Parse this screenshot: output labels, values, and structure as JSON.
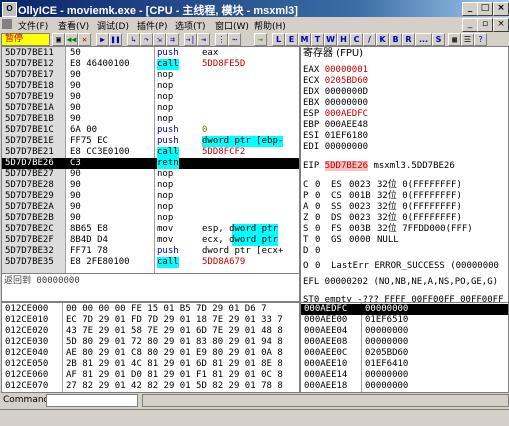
{
  "window": {
    "title": "OllyICE - moviemk.exe - [CPU - 主线程, 模块 - msxml3]",
    "icon": "O"
  },
  "window_buttons": {
    "minimize": "_",
    "maximize": "□",
    "close": "×"
  },
  "menu": [
    "文件(F)",
    "查看(V)",
    "调试(D)",
    "插件(P)",
    "选项(T)",
    "窗口(W)",
    "帮助(H)"
  ],
  "status_label": "暂停",
  "toolbar_letters": [
    "L",
    "E",
    "M",
    "T",
    "W",
    "H",
    "C",
    "/",
    "K",
    "B",
    "R",
    "...",
    "S"
  ],
  "disasm": [
    {
      "addr": "5D7D7BE11",
      "hex": "50",
      "op": "push",
      "arg": "eax",
      "cls": ""
    },
    {
      "addr": "5D7D7BE12",
      "hex": "E8 46400100",
      "op": "call",
      "arg": "5DD8FE5D",
      "cls": "call"
    },
    {
      "addr": "5D7D7BE17",
      "hex": "90",
      "op": "nop",
      "arg": "",
      "cls": ""
    },
    {
      "addr": "5D7D7BE18",
      "hex": "90",
      "op": "nop",
      "arg": "",
      "cls": ""
    },
    {
      "addr": "5D7D7BE19",
      "hex": "90",
      "op": "nop",
      "arg": "",
      "cls": ""
    },
    {
      "addr": "5D7D7BE1A",
      "hex": "90",
      "op": "nop",
      "arg": "",
      "cls": ""
    },
    {
      "addr": "5D7D7BE1B",
      "hex": "90",
      "op": "nop",
      "arg": "",
      "cls": ""
    },
    {
      "addr": "5D7D7BE1C",
      "hex": "6A 00",
      "op": "push",
      "arg": "0",
      "cls": ""
    },
    {
      "addr": "5D7D7BE1E",
      "hex": "FF75 EC",
      "op": "push",
      "arg": "dword ptr [ebp-",
      "cls": "hlarg"
    },
    {
      "addr": "5D7D7BE21",
      "hex": "E8 CC3E0100",
      "op": "call",
      "arg": "5DD8FCF2",
      "cls": "call"
    },
    {
      "addr": "5D7D7BE26",
      "hex": "C3",
      "op": "retn",
      "arg": "",
      "cls": "sel"
    },
    {
      "addr": "5D7D7BE27",
      "hex": "90",
      "op": "nop",
      "arg": "",
      "cls": ""
    },
    {
      "addr": "5D7D7BE28",
      "hex": "90",
      "op": "nop",
      "arg": "",
      "cls": ""
    },
    {
      "addr": "5D7D7BE29",
      "hex": "90",
      "op": "nop",
      "arg": "",
      "cls": ""
    },
    {
      "addr": "5D7D7BE2A",
      "hex": "90",
      "op": "nop",
      "arg": "",
      "cls": ""
    },
    {
      "addr": "5D7D7BE2B",
      "hex": "90",
      "op": "nop",
      "arg": "",
      "cls": ""
    },
    {
      "addr": "5D7D7BE2C",
      "hex": "8B65 E8",
      "op": "mov",
      "arg": "esp, dword ptr",
      "cls": "hlarg2"
    },
    {
      "addr": "5D7D7BE2F",
      "hex": "8B4D D4",
      "op": "mov",
      "arg": "ecx, dword ptr",
      "cls": "hlarg2"
    },
    {
      "addr": "5D7D7BE32",
      "hex": "FF71 78",
      "op": "push",
      "arg": "dword ptr [ecx+",
      "cls": ""
    },
    {
      "addr": "5D7D7BE35",
      "hex": "E8 2FE80100",
      "op": "call",
      "arg": "5DD8A679",
      "cls": "call"
    }
  ],
  "registers": {
    "header": "寄存器 (FPU)",
    "gpr": [
      {
        "name": "EAX",
        "value": "00000001",
        "red": true
      },
      {
        "name": "ECX",
        "value": "0205BD60",
        "red": true
      },
      {
        "name": "EDX",
        "value": "0000000D",
        "red": false
      },
      {
        "name": "EBX",
        "value": "00000000",
        "red": false
      },
      {
        "name": "ESP",
        "value": "000AEDFC",
        "red": true
      },
      {
        "name": "EBP",
        "value": "000AEE48",
        "red": false
      },
      {
        "name": "ESI",
        "value": "01EF6180",
        "red": false
      },
      {
        "name": "EDI",
        "value": "00000000",
        "red": false
      }
    ],
    "eip": {
      "name": "EIP",
      "value": "5DD7BE26",
      "comment": "msxml3.5DD7BE26"
    },
    "segs": [
      {
        "flag": "C",
        "bit": "0",
        "seg": "ES",
        "sel": "0023",
        "desc": "32位 0(FFFFFFFF)"
      },
      {
        "flag": "P",
        "bit": "0",
        "seg": "CS",
        "sel": "001B",
        "desc": "32位 0(FFFFFFFF)"
      },
      {
        "flag": "A",
        "bit": "0",
        "seg": "SS",
        "sel": "0023",
        "desc": "32位 0(FFFFFFFF)"
      },
      {
        "flag": "Z",
        "bit": "0",
        "seg": "DS",
        "sel": "0023",
        "desc": "32位 0(FFFFFFFF)"
      },
      {
        "flag": "S",
        "bit": "0",
        "seg": "FS",
        "sel": "003B",
        "desc": "32位 7FFDD000(FFF)"
      },
      {
        "flag": "T",
        "bit": "0",
        "seg": "GS",
        "sel": "0000",
        "desc": "NULL"
      },
      {
        "flag": "D",
        "bit": "0",
        "seg": "",
        "sel": "",
        "desc": ""
      },
      {
        "flag": "O",
        "bit": "0",
        "seg": "",
        "sel": "",
        "desc": "LastErr ERROR_SUCCESS (00000000"
      }
    ],
    "efl": "EFL 00000202 (NO,NB,NE,A,NS,PO,GE,G)",
    "st0": "ST0 empty -??? FFFF 00FF00FF 00FF00FF"
  },
  "info": {
    "line1": "返回到 00000000"
  },
  "dump": [
    {
      "addr": "012CE000",
      "hex": "00 00 00 00 FE 15 01 B5 7D 29 01 D6 7"
    },
    {
      "addr": "012CE010",
      "hex": "EC 7D 29 01 FD 7D 29 01 18 7E 29 01 33 7"
    },
    {
      "addr": "012CE020",
      "hex": "43 7E 29 01 58 7E 29 01 6D 7E 29 01 48 8"
    },
    {
      "addr": "012CE030",
      "hex": "5D 80 29 01 72 80 29 01 83 80 29 01 94 8"
    },
    {
      "addr": "012CE040",
      "hex": "AE 80 29 01 C8 80 29 01 E9 80 29 01 0A 8"
    },
    {
      "addr": "012CE050",
      "hex": "2B 81 29 01 4C 81 29 01 6D 81 29 01 8E 8"
    },
    {
      "addr": "012CE060",
      "hex": "AF 81 29 01 D0 81 29 01 F1 81 29 01 0C 8"
    },
    {
      "addr": "012CE070",
      "hex": "27 82 29 01 42 82 29 01 5D 82 29 01 78 8"
    }
  ],
  "stack": [
    {
      "addr": "000AEDFC",
      "value": "00000000",
      "sel": true
    },
    {
      "addr": "000AEE00",
      "value": "01EF6510",
      "sel": false
    },
    {
      "addr": "000AEE04",
      "value": "00000000",
      "sel": false
    },
    {
      "addr": "000AEE08",
      "value": "00000000",
      "sel": false
    },
    {
      "addr": "000AEE0C",
      "value": "0205BD60",
      "sel": false
    },
    {
      "addr": "000AEE10",
      "value": "01EF6410",
      "sel": false
    },
    {
      "addr": "000AEE14",
      "value": "00000000",
      "sel": false
    },
    {
      "addr": "000AEE18",
      "value": "00000000",
      "sel": false
    }
  ],
  "command_label": "Command"
}
